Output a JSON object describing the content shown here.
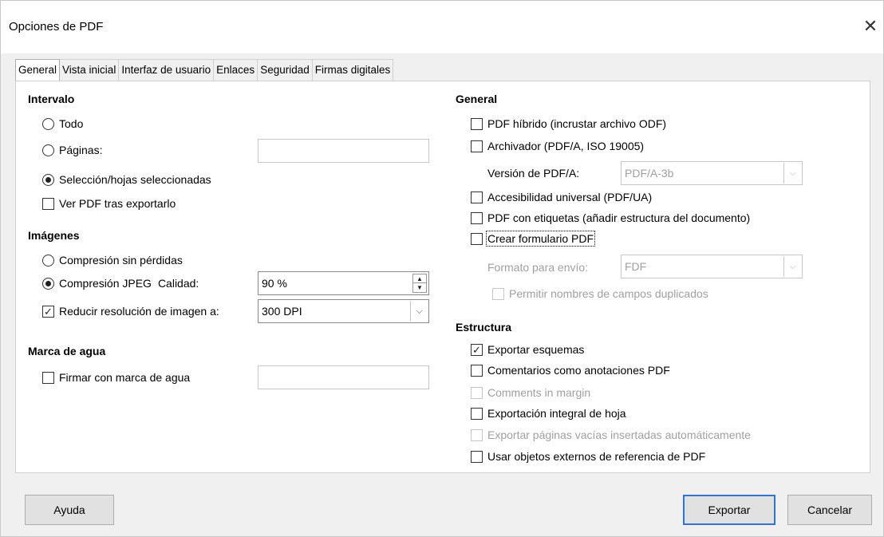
{
  "window": {
    "title": "Opciones de PDF",
    "close_icon": "close-icon"
  },
  "tabs": [
    {
      "label": "General",
      "active": true
    },
    {
      "label": "Vista inicial"
    },
    {
      "label": "Interfaz de usuario"
    },
    {
      "label": "Enlaces"
    },
    {
      "label": "Seguridad"
    },
    {
      "label": "Firmas digitales"
    }
  ],
  "range": {
    "heading": "Intervalo",
    "all_label": "Todo",
    "pages_label": "Páginas:",
    "pages_value": "",
    "selection_label": "Selección/hojas seleccionadas",
    "selected": "selection",
    "view_pdf_label": "Ver PDF tras exportarlo",
    "view_pdf_checked": false
  },
  "images": {
    "heading": "Imágenes",
    "lossless_label": "Compresión sin pérdidas",
    "jpeg_label": "Compresión JPEG",
    "quality_label": "Calidad:",
    "quality_value": "90 %",
    "selected": "jpeg",
    "reduce_label": "Reducir resolución de imagen a:",
    "reduce_checked": true,
    "resolution_value": "300 DPI"
  },
  "watermark": {
    "heading": "Marca de agua",
    "sign_label": "Firmar con marca de agua",
    "sign_checked": false,
    "text_value": ""
  },
  "general": {
    "heading": "General",
    "hybrid_label": "PDF híbrido (incrustar archivo ODF)",
    "archive_label": "Archivador (PDF/A, ISO 19005)",
    "pdfa_version_label": "Versión de PDF/A:",
    "pdfa_version_value": "PDF/A-3b",
    "ua_label": "Accesibilidad universal (PDF/UA)",
    "tagged_label": "PDF con etiquetas (añadir estructura del documento)",
    "form_label": "Crear formulario PDF",
    "submit_format_label": "Formato para envío:",
    "submit_format_value": "FDF",
    "duplicate_names_label": "Permitir nombres de campos duplicados"
  },
  "structure": {
    "heading": "Estructura",
    "outlines_label": "Exportar esquemas",
    "outlines_checked": true,
    "comments_label": "Comentarios como anotaciones PDF",
    "comments_margin_label": "Comments in margin",
    "whole_sheet_label": "Exportación integral de hoja",
    "empty_pages_label": "Exportar páginas vacías insertadas automáticamente",
    "reference_label": "Usar objetos externos de referencia de PDF"
  },
  "buttons": {
    "help": "Ayuda",
    "export": "Exportar",
    "cancel": "Cancelar"
  },
  "colors": {
    "active_tab_marker": "#e51e1e",
    "default_button_border": "#2f75d6"
  }
}
